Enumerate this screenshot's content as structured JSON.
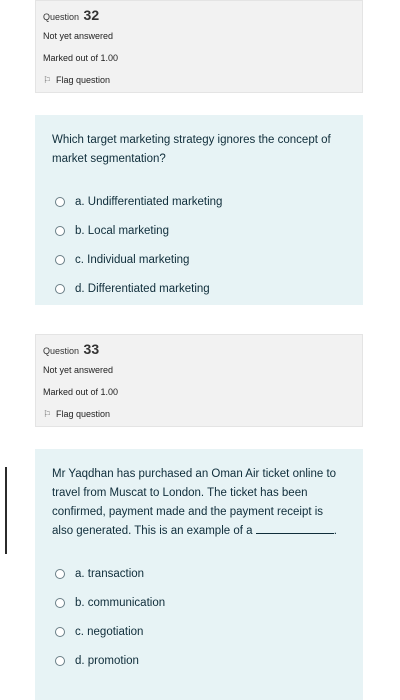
{
  "questions": [
    {
      "label": "Question",
      "number": "32",
      "status": "Not yet answered",
      "marks": "Marked out of 1.00",
      "flag_label": "Flag question",
      "text": "Which target marketing strategy ignores the concept of market segmentation?",
      "options": [
        "a. Undifferentiated marketing",
        "b. Local marketing",
        "c. Individual marketing",
        "d. Differentiated marketing"
      ]
    },
    {
      "label": "Question",
      "number": "33",
      "status": "Not yet answered",
      "marks": "Marked out of 1.00",
      "flag_label": "Flag question",
      "text": "Mr Yaqdhan has purchased an Oman Air ticket online to travel from Muscat to London. The ticket has been confirmed, payment made and the payment receipt is also generated. This is an example of a",
      "text_end": ".",
      "options": [
        "a. transaction",
        "b. communication",
        "c. negotiation",
        "d. promotion"
      ]
    }
  ]
}
